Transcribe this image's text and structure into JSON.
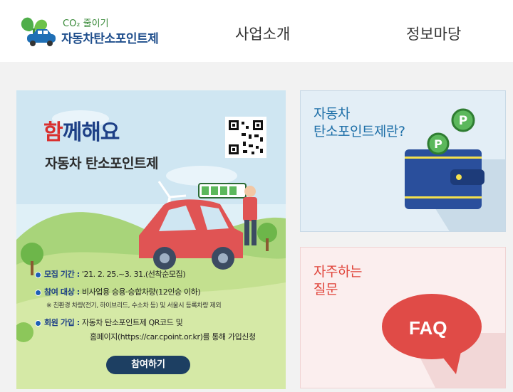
{
  "header": {
    "logo": {
      "sub": "CO₂ 줄이기",
      "title": "자동차탄소포인트제"
    },
    "nav": [
      "사업소개",
      "정보마당"
    ]
  },
  "banner": {
    "headline_accent": "함",
    "headline_rest": "께해요",
    "subtitle": "자동차 탄소포인트제",
    "info": [
      {
        "label": "모집 기간 :",
        "value": "'21. 2. 25.~3. 31.(선착순모집)"
      },
      {
        "label": "참여 대상 :",
        "value": "비사업용 승용·승합차량(12인승 이하)"
      },
      {
        "note": "※ 친환경 차량(전기, 하이브리드, 수소차 등) 및 서울시 등록차량 제외"
      },
      {
        "label": "회원 가입 :",
        "value": "자동차 탄소포인트제 QR코드 및"
      },
      {
        "value2": "홈페이지(https://car.cpoint.or.kr)를 통해 가입신청"
      }
    ],
    "cta": "참여하기",
    "colors": {
      "headline": "#1d3f86",
      "accent": "#d9302f",
      "cta": "#1d3f62"
    }
  },
  "cards": [
    {
      "title_line1": "자동차",
      "title_line2": "탄소포인트제란?",
      "icon": "wallet-icon",
      "bg": "#e3eef6"
    },
    {
      "title_line1": "자주하는",
      "title_line2": "질문",
      "icon": "faq-bubble-icon",
      "faq": "FAQ",
      "bg": "#fbeeee"
    }
  ]
}
